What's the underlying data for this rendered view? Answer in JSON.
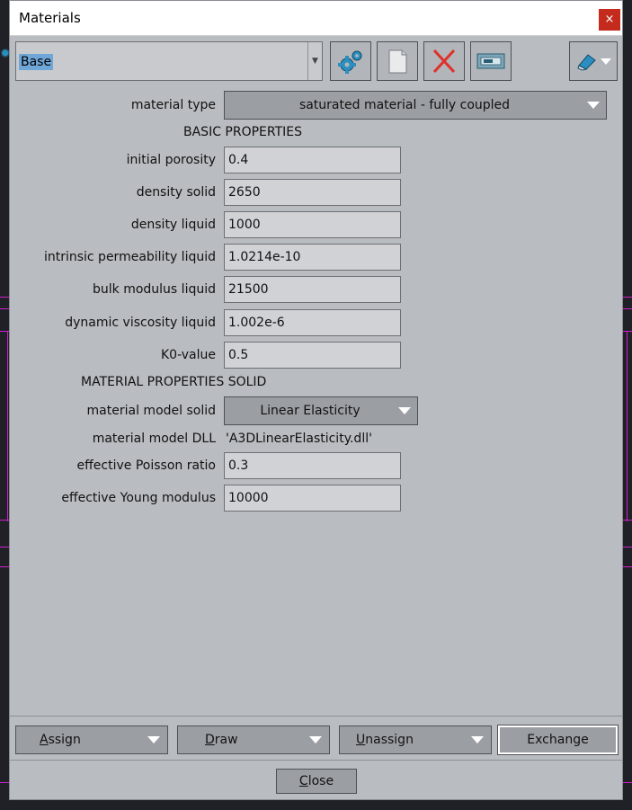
{
  "window": {
    "title": "Materials",
    "close_glyph": "×"
  },
  "material_selector": {
    "value": "Base"
  },
  "toolbar": {
    "buttons": [
      {
        "icon": "gears-icon"
      },
      {
        "icon": "new-document-icon"
      },
      {
        "icon": "delete-icon"
      },
      {
        "icon": "rename-icon"
      },
      {
        "icon": "eraser-menu-icon"
      }
    ]
  },
  "material_type": {
    "label": "material type",
    "value": "saturated material - fully coupled"
  },
  "basic_section": "BASIC  PROPERTIES",
  "basic_fields": [
    {
      "label": "initial porosity",
      "value": "0.4"
    },
    {
      "label": "density solid",
      "value": "2650"
    },
    {
      "label": "density liquid",
      "value": "1000"
    },
    {
      "label": "intrinsic permeability liquid",
      "value": "1.0214e-10"
    },
    {
      "label": "bulk modulus liquid",
      "value": "21500"
    },
    {
      "label": "dynamic viscosity liquid",
      "value": "1.002e-6"
    },
    {
      "label": "K0-value",
      "value": "0.5"
    }
  ],
  "solid_section": "MATERIAL PROPERTIES SOLID",
  "material_model_solid": {
    "label": "material model solid",
    "value": "Linear Elasticity"
  },
  "material_model_dll": {
    "label": "material model DLL",
    "value": "'A3DLinearElasticity.dll'"
  },
  "solid_fields": [
    {
      "label": "effective Poisson ratio",
      "value": "0.3"
    },
    {
      "label": "effective Young modulus",
      "value": "10000"
    }
  ],
  "bottom_buttons": {
    "assign": {
      "first": "A",
      "rest": "ssign"
    },
    "draw": {
      "first": "D",
      "rest": "raw"
    },
    "unassign": {
      "first": "U",
      "rest": "nassign"
    },
    "exchange": "Exchange",
    "close": {
      "first": "C",
      "rest": "lose"
    }
  },
  "colors": {
    "accent": "#6fa6d8",
    "delete_red": "#e0302a",
    "close_red": "#c42b1c",
    "icon_teal": "#2a8fc0"
  }
}
